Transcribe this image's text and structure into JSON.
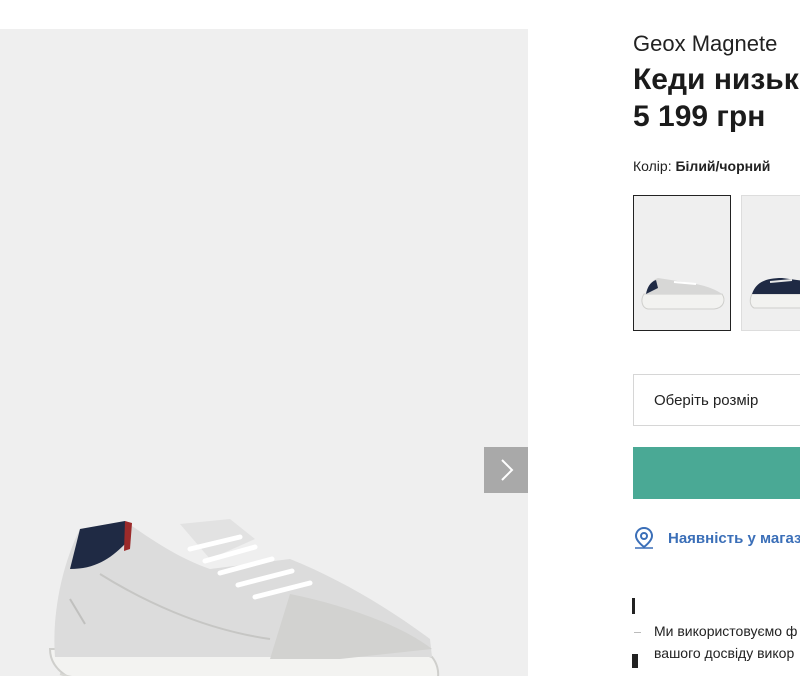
{
  "product": {
    "brand": "Geox Magnete",
    "title": "Кеди низькі",
    "price": "5 199 грн",
    "color_label": "Колір:",
    "color_value": "Білий/чорний"
  },
  "gallery": {
    "next_icon": "chevron-right-icon"
  },
  "size_select": {
    "placeholder": "Оберіть розмір"
  },
  "store_availability": {
    "icon": "map-pin-icon",
    "label": "Наявність у магази"
  },
  "cookie_notice": {
    "line1": "Ми використовуємо ф",
    "line2": "вашого досвіду викор"
  },
  "colors": {
    "accent_green": "#4aa995",
    "link_blue": "#3b6fb8",
    "gallery_bg": "#efefef"
  }
}
